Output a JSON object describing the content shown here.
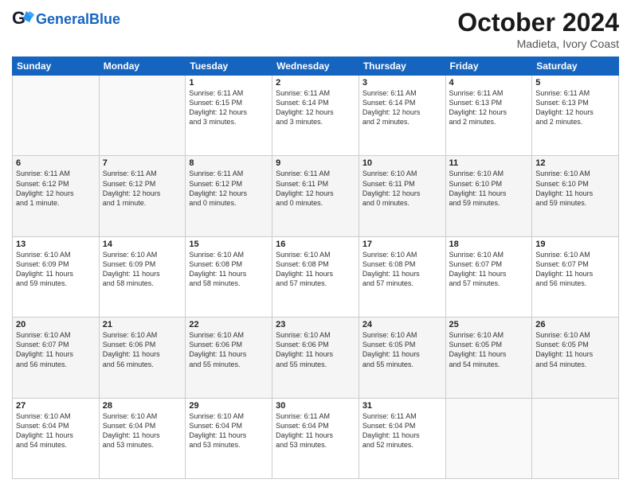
{
  "header": {
    "logo_text_general": "General",
    "logo_text_blue": "Blue",
    "month_title": "October 2024",
    "location": "Madieta, Ivory Coast"
  },
  "days_of_week": [
    "Sunday",
    "Monday",
    "Tuesday",
    "Wednesday",
    "Thursday",
    "Friday",
    "Saturday"
  ],
  "weeks": [
    [
      {
        "day": "",
        "info": ""
      },
      {
        "day": "",
        "info": ""
      },
      {
        "day": "1",
        "info": "Sunrise: 6:11 AM\nSunset: 6:15 PM\nDaylight: 12 hours\nand 3 minutes."
      },
      {
        "day": "2",
        "info": "Sunrise: 6:11 AM\nSunset: 6:14 PM\nDaylight: 12 hours\nand 3 minutes."
      },
      {
        "day": "3",
        "info": "Sunrise: 6:11 AM\nSunset: 6:14 PM\nDaylight: 12 hours\nand 2 minutes."
      },
      {
        "day": "4",
        "info": "Sunrise: 6:11 AM\nSunset: 6:13 PM\nDaylight: 12 hours\nand 2 minutes."
      },
      {
        "day": "5",
        "info": "Sunrise: 6:11 AM\nSunset: 6:13 PM\nDaylight: 12 hours\nand 2 minutes."
      }
    ],
    [
      {
        "day": "6",
        "info": "Sunrise: 6:11 AM\nSunset: 6:12 PM\nDaylight: 12 hours\nand 1 minute."
      },
      {
        "day": "7",
        "info": "Sunrise: 6:11 AM\nSunset: 6:12 PM\nDaylight: 12 hours\nand 1 minute."
      },
      {
        "day": "8",
        "info": "Sunrise: 6:11 AM\nSunset: 6:12 PM\nDaylight: 12 hours\nand 0 minutes."
      },
      {
        "day": "9",
        "info": "Sunrise: 6:11 AM\nSunset: 6:11 PM\nDaylight: 12 hours\nand 0 minutes."
      },
      {
        "day": "10",
        "info": "Sunrise: 6:10 AM\nSunset: 6:11 PM\nDaylight: 12 hours\nand 0 minutes."
      },
      {
        "day": "11",
        "info": "Sunrise: 6:10 AM\nSunset: 6:10 PM\nDaylight: 11 hours\nand 59 minutes."
      },
      {
        "day": "12",
        "info": "Sunrise: 6:10 AM\nSunset: 6:10 PM\nDaylight: 11 hours\nand 59 minutes."
      }
    ],
    [
      {
        "day": "13",
        "info": "Sunrise: 6:10 AM\nSunset: 6:09 PM\nDaylight: 11 hours\nand 59 minutes."
      },
      {
        "day": "14",
        "info": "Sunrise: 6:10 AM\nSunset: 6:09 PM\nDaylight: 11 hours\nand 58 minutes."
      },
      {
        "day": "15",
        "info": "Sunrise: 6:10 AM\nSunset: 6:08 PM\nDaylight: 11 hours\nand 58 minutes."
      },
      {
        "day": "16",
        "info": "Sunrise: 6:10 AM\nSunset: 6:08 PM\nDaylight: 11 hours\nand 57 minutes."
      },
      {
        "day": "17",
        "info": "Sunrise: 6:10 AM\nSunset: 6:08 PM\nDaylight: 11 hours\nand 57 minutes."
      },
      {
        "day": "18",
        "info": "Sunrise: 6:10 AM\nSunset: 6:07 PM\nDaylight: 11 hours\nand 57 minutes."
      },
      {
        "day": "19",
        "info": "Sunrise: 6:10 AM\nSunset: 6:07 PM\nDaylight: 11 hours\nand 56 minutes."
      }
    ],
    [
      {
        "day": "20",
        "info": "Sunrise: 6:10 AM\nSunset: 6:07 PM\nDaylight: 11 hours\nand 56 minutes."
      },
      {
        "day": "21",
        "info": "Sunrise: 6:10 AM\nSunset: 6:06 PM\nDaylight: 11 hours\nand 56 minutes."
      },
      {
        "day": "22",
        "info": "Sunrise: 6:10 AM\nSunset: 6:06 PM\nDaylight: 11 hours\nand 55 minutes."
      },
      {
        "day": "23",
        "info": "Sunrise: 6:10 AM\nSunset: 6:06 PM\nDaylight: 11 hours\nand 55 minutes."
      },
      {
        "day": "24",
        "info": "Sunrise: 6:10 AM\nSunset: 6:05 PM\nDaylight: 11 hours\nand 55 minutes."
      },
      {
        "day": "25",
        "info": "Sunrise: 6:10 AM\nSunset: 6:05 PM\nDaylight: 11 hours\nand 54 minutes."
      },
      {
        "day": "26",
        "info": "Sunrise: 6:10 AM\nSunset: 6:05 PM\nDaylight: 11 hours\nand 54 minutes."
      }
    ],
    [
      {
        "day": "27",
        "info": "Sunrise: 6:10 AM\nSunset: 6:04 PM\nDaylight: 11 hours\nand 54 minutes."
      },
      {
        "day": "28",
        "info": "Sunrise: 6:10 AM\nSunset: 6:04 PM\nDaylight: 11 hours\nand 53 minutes."
      },
      {
        "day": "29",
        "info": "Sunrise: 6:10 AM\nSunset: 6:04 PM\nDaylight: 11 hours\nand 53 minutes."
      },
      {
        "day": "30",
        "info": "Sunrise: 6:11 AM\nSunset: 6:04 PM\nDaylight: 11 hours\nand 53 minutes."
      },
      {
        "day": "31",
        "info": "Sunrise: 6:11 AM\nSunset: 6:04 PM\nDaylight: 11 hours\nand 52 minutes."
      },
      {
        "day": "",
        "info": ""
      },
      {
        "day": "",
        "info": ""
      }
    ]
  ]
}
